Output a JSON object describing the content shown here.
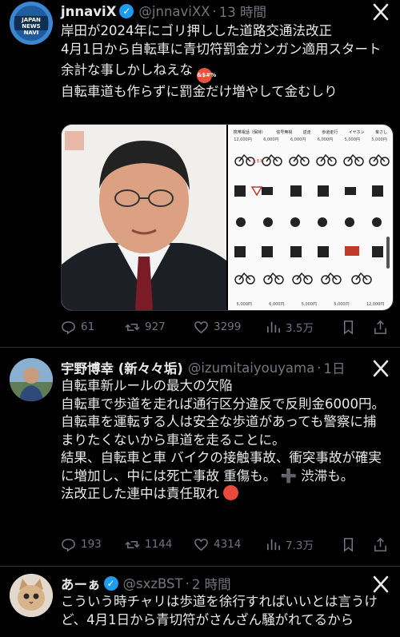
{
  "posts": [
    {
      "name": "jnnaviX",
      "handle": "@jnnaviXX",
      "time": "13 時間",
      "avatar_text": "JAPAN NEWS NAVI",
      "lines": [
        "岸田が2024年にゴリ押しした道路交通法改正",
        "4月1日から自転車に青切符罰金ガンガン適用スタート",
        "余計な事しかしねえな",
        "自転車道も作らずに罰金だけ増やして金むしり"
      ],
      "emoji_label": "&$#%",
      "counts": {
        "replies": "61",
        "reposts": "927",
        "likes": "3299",
        "views": "3.5万"
      },
      "infographic": {
        "row1": [
          "携帯電話（保持）",
          "信号無視",
          "逆走",
          "歩道走行",
          "イヤホン",
          "傘さし"
        ],
        "row1_fines": [
          "12,000円",
          "6,000円",
          "6,000円",
          "6,000円",
          "5,000円",
          "5,000円"
        ],
        "sign_text": "止まれ",
        "last_row_fines": [
          "5,000円",
          "6,000円",
          "5,000円",
          "5,000円",
          "12,000円"
        ]
      }
    },
    {
      "name": "宇野博幸 (新々々垢)",
      "handle": "@izumitaiyouyama",
      "time": "1日",
      "lines": [
        "自転車新ルールの最大の欠陥",
        "自転車で歩道を走れば通行区分違反で反則金6000円。",
        "自転車を運転する人は安全な歩道があっても警察に捕まりたくないから車道を走ることに。",
        "結果、自転車と車 バイクの接触事故、衝突事故が確実に増加し、中には死亡事故 重傷も。 ➕ 渋滞も。",
        "法改正した連中は責任取れ"
      ],
      "counts": {
        "replies": "193",
        "reposts": "1144",
        "likes": "4314",
        "views": "7.3万"
      }
    },
    {
      "name": "あーぁ",
      "handle": "@sxzBST",
      "time": "2 時間",
      "lines": [
        "こういう時チャリは歩道を徐行すればいいとは言うけど、4月1日から青切符がさんざん騒がれてるから"
      ]
    }
  ],
  "colors": {
    "accent": "#1d9bf0",
    "text": "#e7e9ea",
    "muted": "#71767b",
    "divider": "#2f3336"
  }
}
